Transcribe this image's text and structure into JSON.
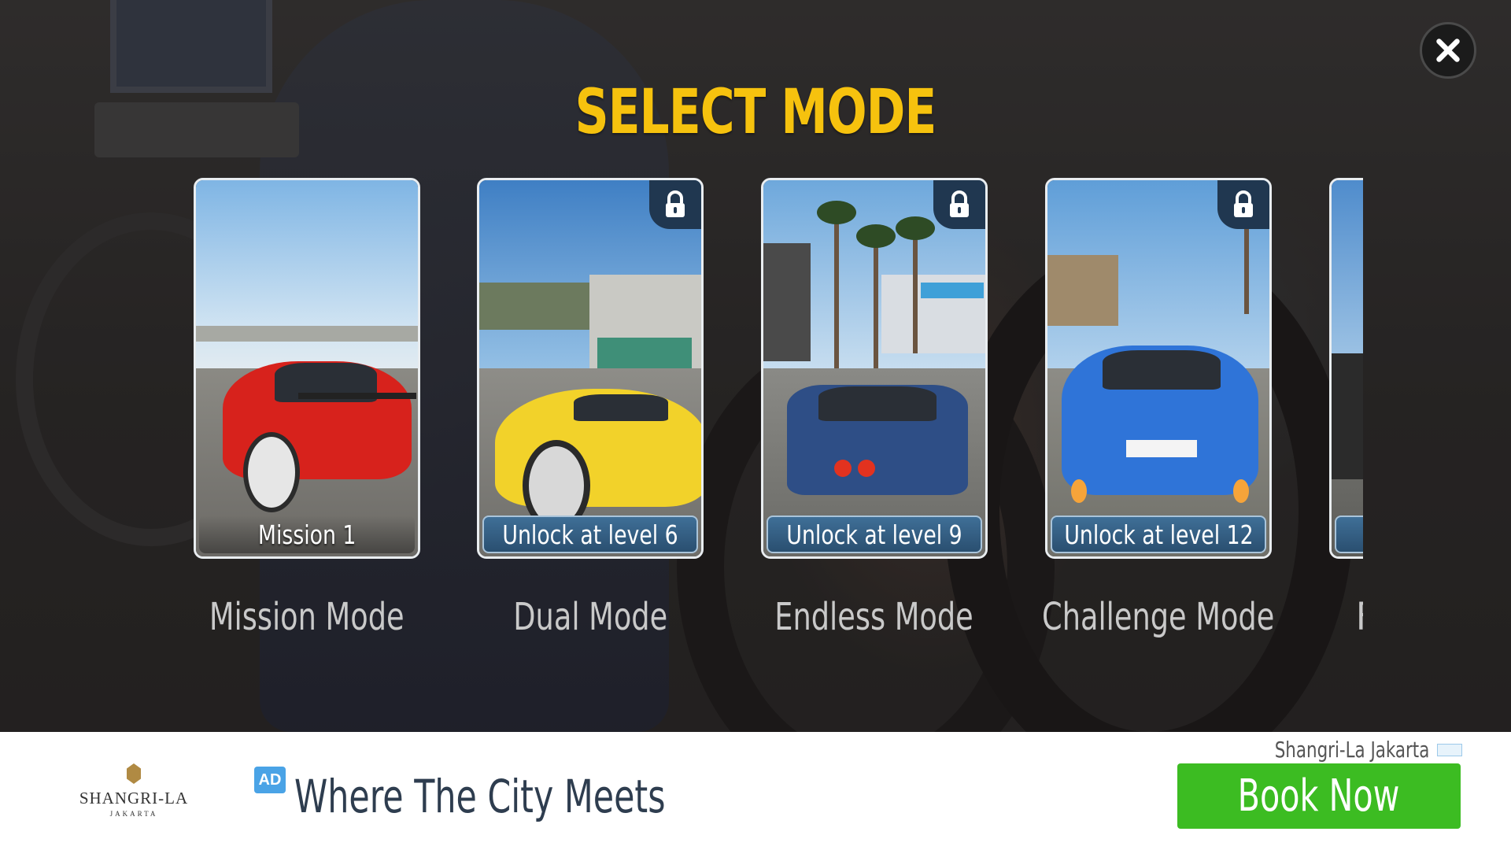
{
  "title": "SELECT MODE",
  "close": {
    "icon": "close-icon"
  },
  "modes": [
    {
      "name": "Mission Mode",
      "card_label": "Mission 1",
      "locked": false
    },
    {
      "name": "Dual Mode",
      "card_label": "Unlock at level 6",
      "locked": true
    },
    {
      "name": "Endless Mode",
      "card_label": "Unlock at level 9",
      "locked": true
    },
    {
      "name": "Challenge Mode",
      "card_label": "Unlock at level 12",
      "locked": true
    },
    {
      "name": "F",
      "card_label": "",
      "locked": true
    }
  ],
  "ad": {
    "logo_name": "SHANGRI-LA",
    "logo_city": "JAKARTA",
    "badge": "AD",
    "headline": "Where The City Meets",
    "advertiser": "Shangri-La Jakarta",
    "cta": "Book Now"
  },
  "colors": {
    "title": "#f6c20e",
    "locked_label": "#2a4f70",
    "cta": "#3cbc22"
  }
}
